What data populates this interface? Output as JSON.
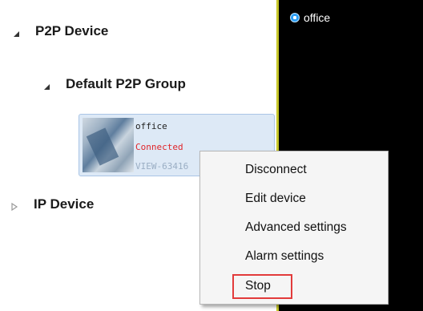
{
  "tree": {
    "nodes": {
      "p2p_device": {
        "label": "P2P Device",
        "state": "expanded"
      },
      "default_group": {
        "label": "Default P2P Group",
        "state": "expanded"
      },
      "ip_device": {
        "label": "IP Device",
        "state": "collapsed"
      }
    },
    "device": {
      "name": "office",
      "status": "Connected",
      "id": "VIEW-63416",
      "status_color": "#e0262b"
    }
  },
  "video": {
    "channel_label": "office",
    "border_color": "#c7c72a"
  },
  "context_menu": {
    "items": [
      {
        "label": "Disconnect"
      },
      {
        "label": "Edit device"
      },
      {
        "label": "Advanced settings"
      },
      {
        "label": "Alarm settings"
      },
      {
        "label": "Stop",
        "highlighted": true
      }
    ],
    "highlight_color": "#e23b3b"
  }
}
